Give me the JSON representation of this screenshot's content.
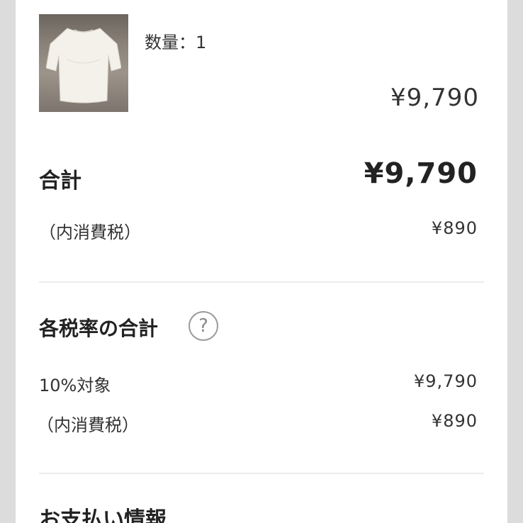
{
  "item": {
    "image_alt": "white blouse",
    "quantity_text": "数量：1",
    "price": "¥9,790"
  },
  "summary": {
    "total_label": "合計",
    "total_value": "¥9,790",
    "tax_label": "（内消費税）",
    "tax_value": "¥890"
  },
  "tax_rates": {
    "title": "各税率の合計",
    "help_icon": "?",
    "rate_label": "10%対象",
    "rate_value": "¥9,790",
    "tax_label": "（内消費税）",
    "tax_value": "¥890"
  },
  "payment": {
    "title": "お支払い情報"
  }
}
